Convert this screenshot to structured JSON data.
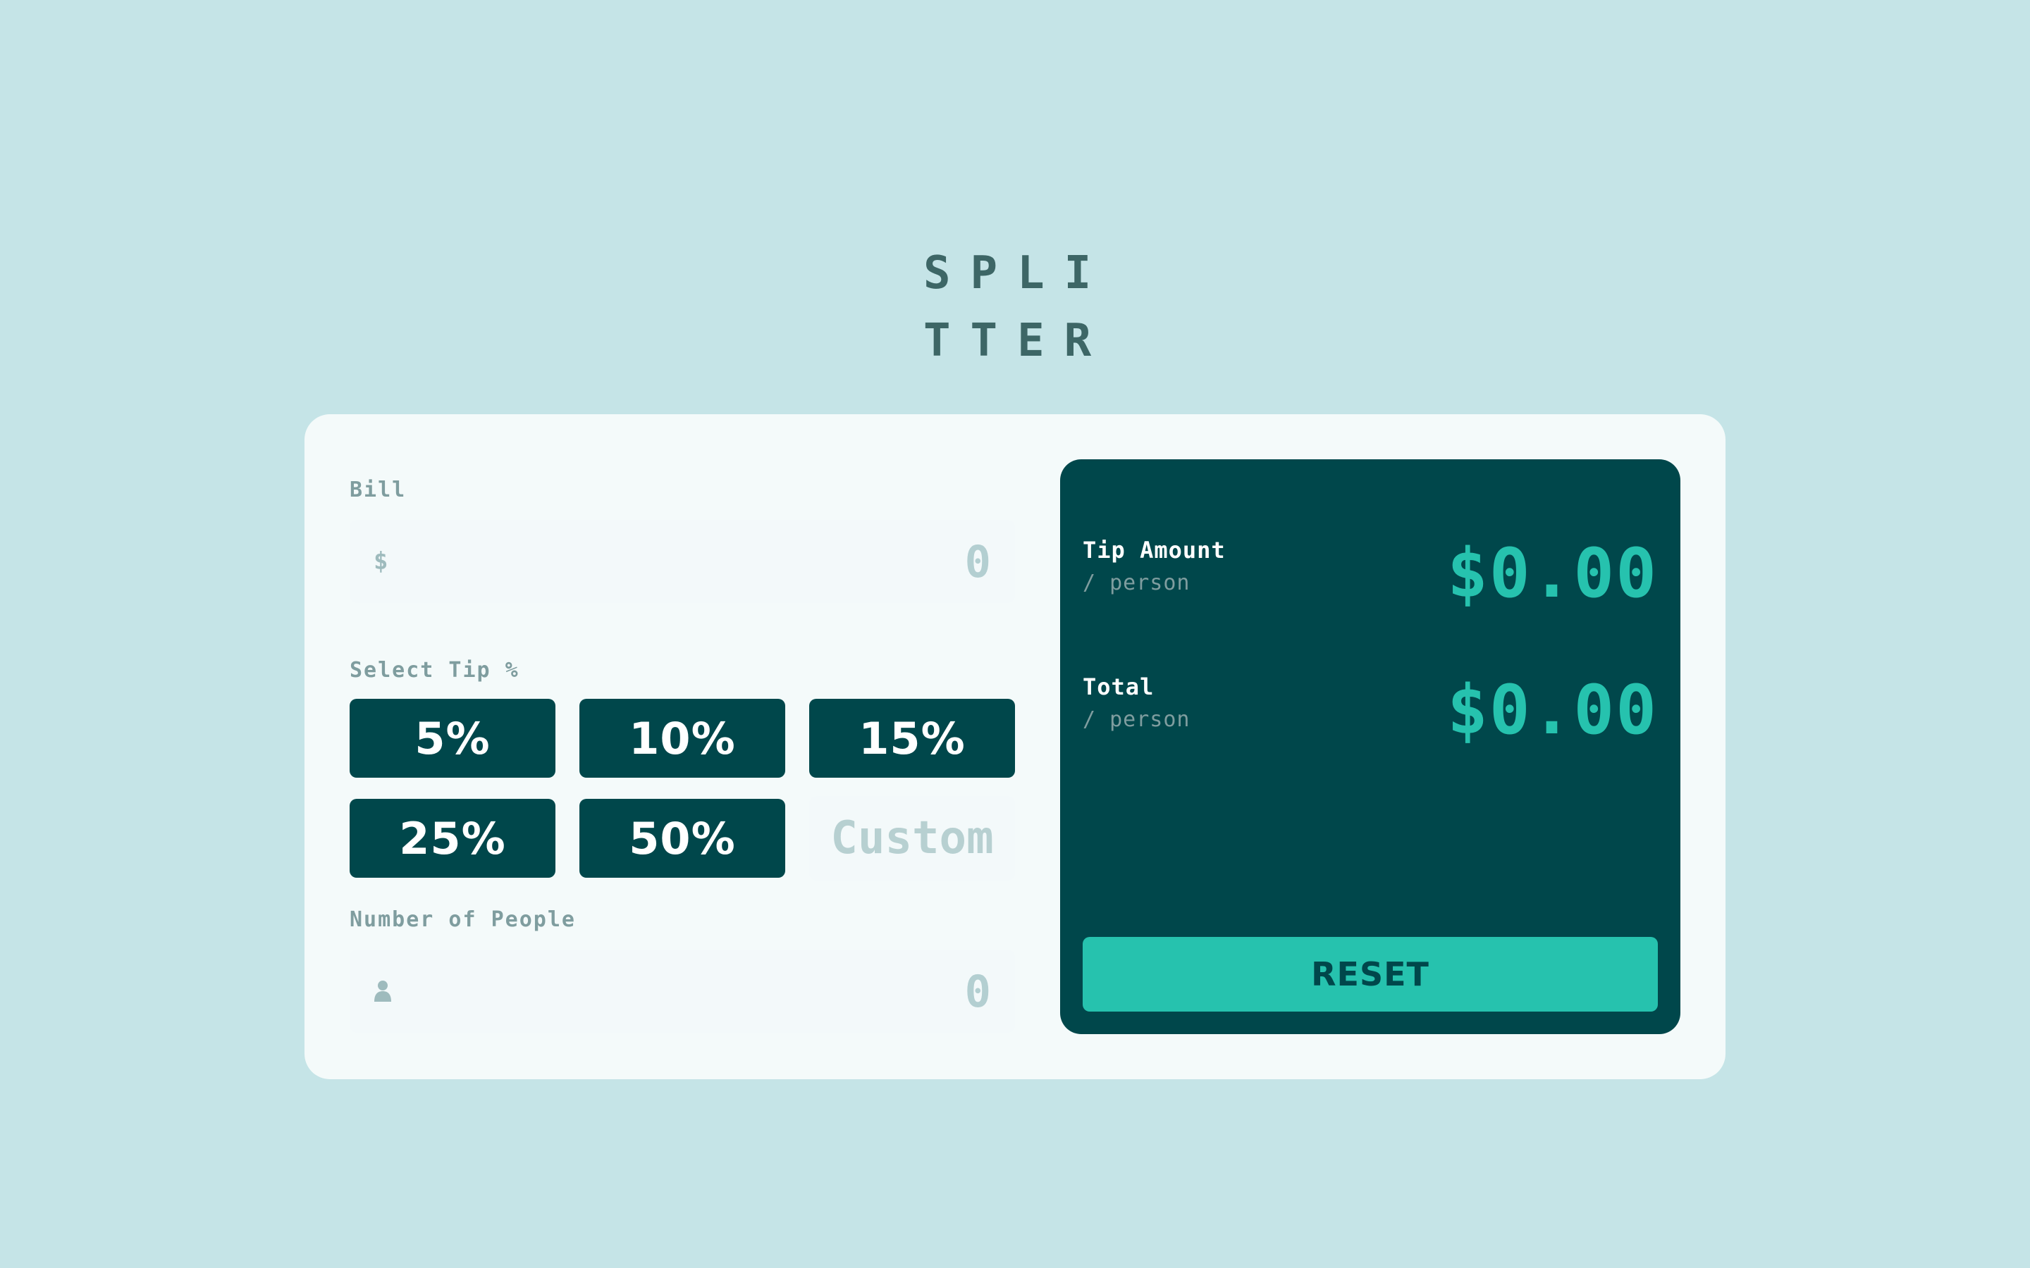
{
  "logo": {
    "line1": "SPLI",
    "line2": "TTER"
  },
  "bill": {
    "label": "Bill",
    "currency_symbol": "$",
    "value": "0",
    "icon": "dollar-icon"
  },
  "tip": {
    "label": "Select Tip %",
    "options": [
      "5%",
      "10%",
      "15%",
      "25%",
      "50%"
    ],
    "custom_placeholder": "Custom"
  },
  "people": {
    "label": "Number of People",
    "value": "0",
    "icon": "person-icon"
  },
  "results": {
    "tip_amount": {
      "title": "Tip Amount",
      "sub": "/ person",
      "value": "$0.00"
    },
    "total": {
      "title": "Total",
      "sub": "/ person",
      "value": "$0.00"
    },
    "reset_label": "RESET"
  },
  "colors": {
    "background": "#c5e4e7",
    "card": "#f4fafa",
    "dark_cyan": "#00474b",
    "accent": "#26c2ae",
    "label_grey": "#7f9d9f",
    "logo": "#3d6666"
  }
}
